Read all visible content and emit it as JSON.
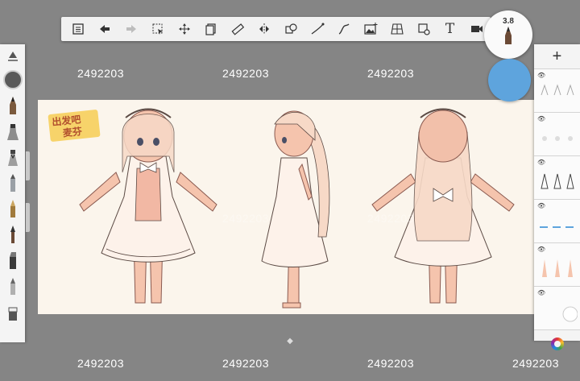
{
  "watermark": {
    "text": "2492203"
  },
  "brush": {
    "size": "3.8"
  },
  "colors": {
    "active_color": "#5ea4dd",
    "canvas_bg": "#fbf5ec",
    "skin": "#f5c4ad",
    "line": "#5b4a44"
  },
  "toolbar": {
    "icons": [
      "list-icon",
      "undo-icon",
      "redo-icon",
      "selection-icon",
      "transform-icon",
      "layer-icon",
      "ruler-icon",
      "symmetry-icon",
      "shape-icon",
      "curve-icon",
      "stroke-icon",
      "image-icon",
      "perspective-icon",
      "fill-icon",
      "text-icon",
      "video-icon"
    ],
    "text_tool_label": "T"
  },
  "canvas": {
    "logo_text_line1": "出发吧",
    "logo_text_line2": "麦芬"
  },
  "layers": {
    "add_label": "+",
    "count": 6
  }
}
